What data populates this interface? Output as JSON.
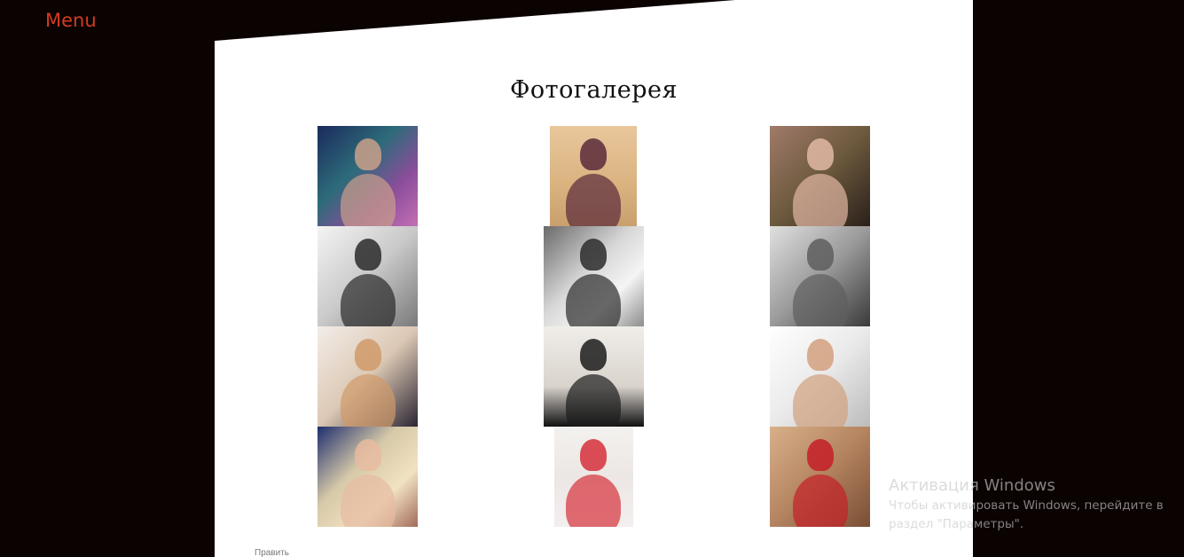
{
  "nav": {
    "menu_label": "Menu"
  },
  "gallery": {
    "title": "Фотогалерея",
    "photos": [
      {
        "name": "photo-1",
        "bg": "linear-gradient(135deg,#1b2a5c 0%,#2d6b7a 40%,#8a4d9a 70%,#c46fb5 100%)",
        "figure": "#caa08a",
        "w": 113
      },
      {
        "name": "photo-2",
        "bg": "linear-gradient(180deg,#e9c79c 0%,#d9b27f 60%,#c9a06d 100%)",
        "figure": "#5a2a3a",
        "w": 98
      },
      {
        "name": "photo-3",
        "bg": "linear-gradient(135deg,#a07a6a 0%,#6d5a3e 50%,#2a201a 100%)",
        "figure": "#e2b8a4",
        "w": 113
      },
      {
        "name": "photo-4",
        "bg": "linear-gradient(135deg,#f4f4f4 0%,#c9c9c9 50%,#7a7a7a 100%)",
        "figure": "#2a2a2a",
        "w": 113
      },
      {
        "name": "photo-5",
        "bg": "linear-gradient(135deg,#6a6a6a 0%,#d8d8d8 45%,#f4f4f4 70%,#8d8d8d 100%)",
        "figure": "#2b2b2b",
        "w": 113
      },
      {
        "name": "photo-6",
        "bg": "linear-gradient(135deg,#e0e0e0 0%,#9a9a9a 50%,#3a3a3a 100%)",
        "figure": "#5e5e5e",
        "w": 113
      },
      {
        "name": "photo-7",
        "bg": "linear-gradient(135deg,#f2ede8 0%,#dcc8b4 50%,#2b2633 100%)",
        "figure": "#d09a6a",
        "w": 113
      },
      {
        "name": "photo-8",
        "bg": "linear-gradient(180deg,#f0ede9 0%,#d9d3cc 60%,#111111 100%)",
        "figure": "#1c1c1c",
        "w": 113
      },
      {
        "name": "photo-9",
        "bg": "linear-gradient(135deg,#ffffff 0%,#eaeaea 50%,#bcbcbc 100%)",
        "figure": "#d2a07e",
        "w": 113
      },
      {
        "name": "photo-10",
        "bg": "linear-gradient(135deg,#1e2e6e 0%,#d6c9a8 40%,#f1e2c2 70%,#a36a5a 100%)",
        "figure": "#e7bba0",
        "w": 113
      },
      {
        "name": "photo-11",
        "bg": "linear-gradient(180deg,#f3f1ef 0%,#ece7e4 50%,#f3efef 100%)",
        "figure": "#d6303b",
        "w": 89
      },
      {
        "name": "photo-12",
        "bg": "linear-gradient(135deg,#d8b08a 0%,#b48460 50%,#7a4d34 100%)",
        "figure": "#c41f28",
        "w": 113
      }
    ]
  },
  "footer": {
    "edit_label": "Править"
  },
  "watermark": {
    "title": "Активация Windows",
    "subtitle": "Чтобы активировать Windows, перейдите в раздел \"Параметры\"."
  },
  "colors": {
    "background": "#0b0202",
    "panel": "#ffffff",
    "menu_accent": "#d23c22"
  }
}
